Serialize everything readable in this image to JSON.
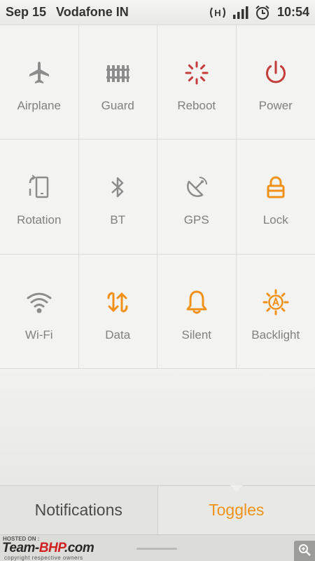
{
  "status_bar": {
    "date": "Sep 15",
    "carrier": "Vodafone IN",
    "network": "H",
    "time": "10:54",
    "icons": [
      "hspa-icon",
      "signal-icon",
      "alarm-icon"
    ]
  },
  "toggles": [
    {
      "label": "Airplane",
      "icon": "airplane-icon",
      "color": "#8c8c8c"
    },
    {
      "label": "Guard",
      "icon": "guard-icon",
      "color": "#8c8c8c"
    },
    {
      "label": "Reboot",
      "icon": "reboot-icon",
      "color": "#c43c3c"
    },
    {
      "label": "Power",
      "icon": "power-icon",
      "color": "#c43c3c"
    },
    {
      "label": "Rotation",
      "icon": "rotation-icon",
      "color": "#8c8c8c"
    },
    {
      "label": "BT",
      "icon": "bluetooth-icon",
      "color": "#8c8c8c"
    },
    {
      "label": "GPS",
      "icon": "gps-icon",
      "color": "#8c8c8c"
    },
    {
      "label": "Lock",
      "icon": "lock-icon",
      "color": "#f0921a"
    },
    {
      "label": "Wi-Fi",
      "icon": "wifi-icon",
      "color": "#8c8c8c"
    },
    {
      "label": "Data",
      "icon": "data-icon",
      "color": "#f0921a"
    },
    {
      "label": "Silent",
      "icon": "bell-icon",
      "color": "#f0921a"
    },
    {
      "label": "Backlight",
      "icon": "backlight-icon",
      "color": "#f0921a"
    }
  ],
  "tabs": {
    "notifications": "Notifications",
    "toggles": "Toggles",
    "active_color": "#f0921a"
  },
  "watermark": {
    "hosted": "HOSTED ON :",
    "logo_team": "Team-",
    "logo_bhp": "BHP",
    "logo_com": ".com",
    "copyright": "copyright respective owners"
  }
}
